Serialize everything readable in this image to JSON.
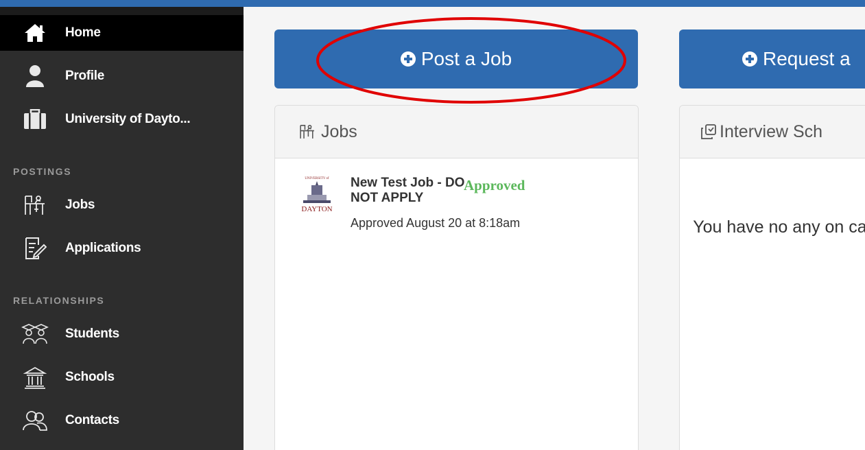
{
  "sidebar": {
    "items": [
      {
        "label": "Home",
        "icon": "home-icon"
      },
      {
        "label": "Profile",
        "icon": "user-icon"
      },
      {
        "label": "University of Dayto...",
        "icon": "briefcase-icon"
      }
    ],
    "sections": [
      {
        "title": "POSTINGS",
        "items": [
          {
            "label": "Jobs",
            "icon": "jobs-desk-icon"
          },
          {
            "label": "Applications",
            "icon": "application-doc-icon"
          }
        ]
      },
      {
        "title": "RELATIONSHIPS",
        "items": [
          {
            "label": "Students",
            "icon": "students-icon"
          },
          {
            "label": "Schools",
            "icon": "school-building-icon"
          },
          {
            "label": "Contacts",
            "icon": "contacts-icon"
          }
        ]
      }
    ]
  },
  "buttons": {
    "post_job": "Post a Job",
    "request": "Request a"
  },
  "jobs_card": {
    "title": "Jobs",
    "items": [
      {
        "title": "New Test Job - DO NOT APPLY",
        "status": "Approved",
        "date": "Approved August 20 at 8:18am"
      }
    ]
  },
  "interview_card": {
    "title": "Interview Sch",
    "empty_text": "You have no any on camp ye"
  },
  "colors": {
    "accent": "#2f6bb0",
    "sidebar_bg": "#2d2d2d",
    "active_bg": "#000000",
    "status_approved": "#5cb85c",
    "annotation": "#e00000"
  }
}
